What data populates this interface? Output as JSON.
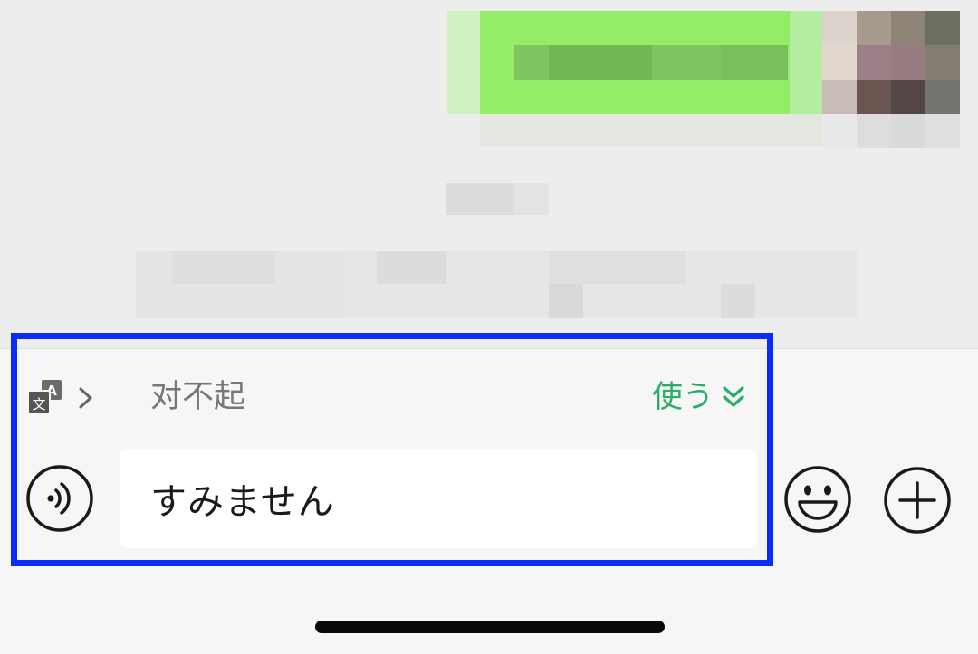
{
  "chat": {
    "redacted": true
  },
  "translation_bar": {
    "icon": "translate-icon",
    "chevron_icon": "chevron-right-icon",
    "original_text": "对不起",
    "use_label": "使う",
    "use_icon": "double-chevron-down-icon",
    "accent_color": "#2aae67"
  },
  "input": {
    "voice_icon": "voice-icon",
    "value": "すみません",
    "emoji_icon": "emoji-icon",
    "plus_icon": "plus-icon"
  },
  "highlight": {
    "color": "#0a2cf5"
  }
}
